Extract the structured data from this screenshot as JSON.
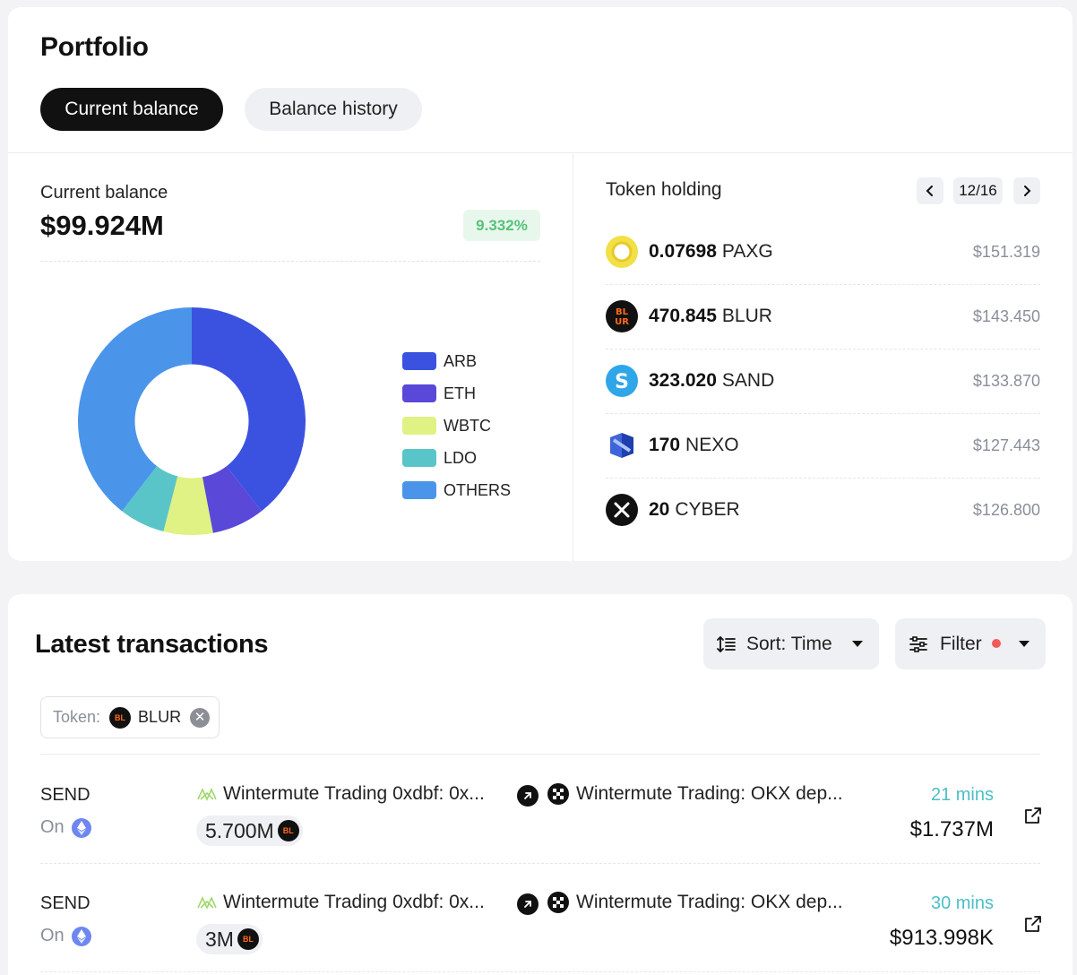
{
  "portfolio": {
    "title": "Portfolio",
    "tabs": [
      {
        "label": "Current balance",
        "active": true
      },
      {
        "label": "Balance history",
        "active": false
      }
    ],
    "balance": {
      "label": "Current balance",
      "value": "$99.924M",
      "change": "9.332%",
      "change_color": "#57c27a"
    }
  },
  "chart_data": {
    "type": "pie",
    "title": "",
    "labels": [
      "ARB",
      "ETH",
      "WBTC",
      "LDO",
      "OTHERS"
    ],
    "values": [
      39.5,
      7.5,
      7.0,
      6.5,
      39.5
    ],
    "colors": [
      "#3b52e0",
      "#5a48d8",
      "#dff283",
      "#5ac5c8",
      "#4a95ea"
    ],
    "inner_radius_ratio": 0.5,
    "legend_position": "right"
  },
  "token_holding": {
    "title": "Token holding",
    "page": "12/16",
    "tokens": [
      {
        "amount": "0.07698",
        "symbol": "PAXG",
        "usd": "$151.319",
        "icon": "paxg-icon"
      },
      {
        "amount": "470.845",
        "symbol": "BLUR",
        "usd": "$143.450",
        "icon": "blur-icon"
      },
      {
        "amount": "323.020",
        "symbol": "SAND",
        "usd": "$133.870",
        "icon": "sand-icon"
      },
      {
        "amount": "170",
        "symbol": "NEXO",
        "usd": "$127.443",
        "icon": "nexo-icon"
      },
      {
        "amount": "20",
        "symbol": "CYBER",
        "usd": "$126.800",
        "icon": "cyber-icon"
      }
    ]
  },
  "transactions": {
    "title": "Latest transactions",
    "sort_label": "Sort: Time",
    "filter_label": "Filter",
    "filter_active_color": "#f25a5a",
    "chip": {
      "label": "Token:",
      "value": "BLUR"
    },
    "rows": [
      {
        "type": "SEND",
        "on_label": "On",
        "from": "Wintermute Trading 0xdbf: 0x...",
        "to": "Wintermute Trading: OKX dep...",
        "amount": "5.700M",
        "time": "21 mins",
        "usd": "$1.737M"
      },
      {
        "type": "SEND",
        "on_label": "On",
        "from": "Wintermute Trading 0xdbf: 0x...",
        "to": "Wintermute Trading: OKX dep...",
        "amount": "3M",
        "time": "30 mins",
        "usd": "$913.998K"
      }
    ]
  }
}
